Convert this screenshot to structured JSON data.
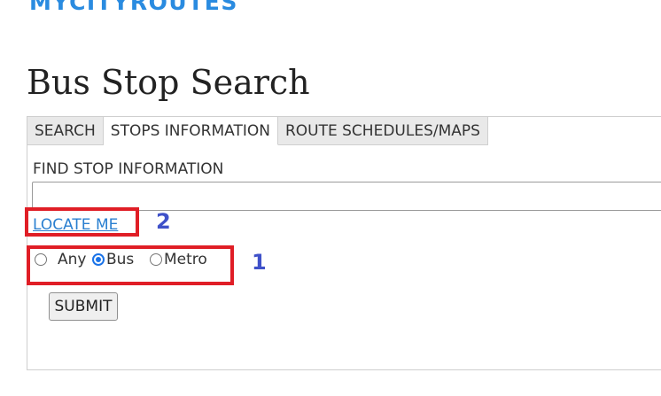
{
  "app": {
    "logo_text": "MYCITYROUTES",
    "brand_color": "#2a8be0"
  },
  "page": {
    "title": "Bus Stop Search"
  },
  "tabs": [
    {
      "label": "SEARCH",
      "active": false
    },
    {
      "label": "STOPS INFORMATION",
      "active": true
    },
    {
      "label": "ROUTE SCHEDULES/MAPS",
      "active": false
    }
  ],
  "stop_search": {
    "label": "FIND STOP INFORMATION",
    "value": "",
    "placeholder": ""
  },
  "locate": {
    "label": "LOCATE ME"
  },
  "transit_type": {
    "options": [
      {
        "label": "Any",
        "checked": false
      },
      {
        "label": "Bus",
        "checked": true
      },
      {
        "label": "Metro",
        "checked": false
      }
    ]
  },
  "submit": {
    "label": "SUBMIT"
  },
  "annotations": {
    "color": "#e01e26",
    "number_color": "#3f51c9",
    "locate_number": "2",
    "radio_number": "1"
  }
}
